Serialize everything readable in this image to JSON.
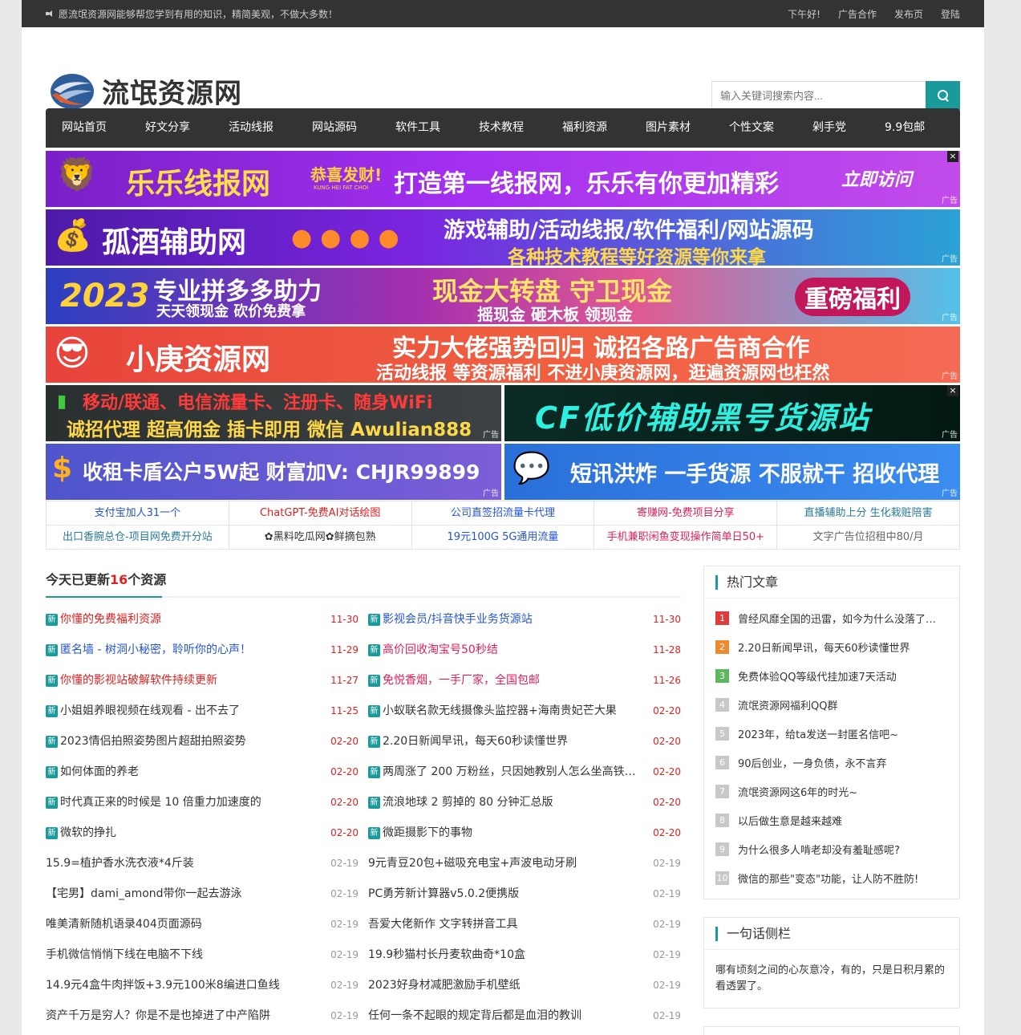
{
  "topbar": {
    "notice": "愿流氓资源网能够帮您学到有用的知识，精简美观，不做大多数！",
    "links": [
      "下午好!",
      "广告合作",
      "发布页",
      "登陆"
    ]
  },
  "site": {
    "logo_text": "流氓资源网"
  },
  "search": {
    "placeholder": "输入关键词搜索内容..."
  },
  "nav": [
    "网站首页",
    "好文分享",
    "活动线报",
    "网站源码",
    "软件工具",
    "技术教程",
    "福利资源",
    "图片素材",
    "个性文案",
    "剁手党",
    "9.9包邮"
  ],
  "ads": {
    "tag": "广告",
    "close": "×",
    "ad1": {
      "title": "乐乐线报网",
      "badge": "恭喜发财!",
      "badge_sub": "KUNG HEI FAT CHOI",
      "slogan": "打造第一线报网，乐乐有你更加精彩",
      "cta": "立即访问"
    },
    "ad2": {
      "title": "孤酒辅助网",
      "line1": "游戏辅助/活动线报/软件福利/网站源码",
      "line2": "各种技术教程等好资源等你来拿"
    },
    "ad3": {
      "year": "2023",
      "line1": "专业拼多多助力",
      "line2": "天天领现金 砍价免费拿",
      "line3": "现金大转盘 守卫现金",
      "line4": "摇现金 砸木板 领现金",
      "badge": "重磅福利"
    },
    "ad4": {
      "title": "小庚资源网",
      "line1": "实力大佬强势回归 诚招各路广告商合作",
      "line2": "活动线报 等资源福利 不进小庚资源网，逛遍资源网也枉然"
    },
    "ad5": {
      "line1": "移动/联通、电信流量卡、注册卡、随身WiFi",
      "line2": "诚招代理 超高佣金 插卡即用 微信 Awulian888"
    },
    "ad6": {
      "title": "CF低价辅助黑号货源站"
    },
    "ad7": {
      "title": "收租卡盾公户5W起 财富加V: CHJR99899"
    },
    "ad8": {
      "title": "短讯洪炸 一手货源 不服就干 招收代理"
    }
  },
  "text_ads": [
    [
      {
        "t": "支付宝加人31一个",
        "c": "blue"
      },
      {
        "t": "ChatGPT-免费AI对话绘图",
        "c": "red"
      },
      {
        "t": "公司直签招流量卡代理",
        "c": "blue"
      },
      {
        "t": "寄赚网-免费项目分享",
        "c": "pink"
      },
      {
        "t": "直播辅助上分 生化栽赃陪害",
        "c": "teal"
      }
    ],
    [
      {
        "t": "出口香腕总仓-项目网免费开分站",
        "c": "teal"
      },
      {
        "t": "✿黑料吃瓜网✿鲜摘包熟",
        "c": "blk"
      },
      {
        "t": "19元100G 5G通用流量",
        "c": "blue"
      },
      {
        "t": "手机兼职闲鱼变现操作简单日50+",
        "c": "pink"
      },
      {
        "t": "文字广告位招租中80/月",
        "c": "gray"
      }
    ]
  ],
  "main": {
    "title_pre": "今天已更新",
    "count": "16",
    "title_post": "个资源",
    "badge": "新",
    "left": [
      {
        "t": "你懂的免费福利资源",
        "d": "11-30",
        "c": "red",
        "new": true
      },
      {
        "t": "匿名墙 - 树洞小秘密，聆听你的心声！",
        "d": "11-29",
        "c": "blue",
        "new": true
      },
      {
        "t": "你懂的影视站破解软件持续更新",
        "d": "11-27",
        "c": "red",
        "new": true
      },
      {
        "t": "小姐姐养眼视频在线观看 - 出不去了",
        "d": "11-25",
        "c": "blk",
        "new": true
      },
      {
        "t": "2023情侣拍照姿势图片超甜拍照姿势",
        "d": "02-20",
        "c": "blk",
        "new": true
      },
      {
        "t": "如何体面的养老",
        "d": "02-20",
        "c": "blk",
        "new": true
      },
      {
        "t": "时代真正来的时候是 10 倍重力加速度的",
        "d": "02-20",
        "c": "blk",
        "new": true
      },
      {
        "t": "微软的挣扎",
        "d": "02-20",
        "c": "blk",
        "new": true
      },
      {
        "t": "15.9=植护香水洗衣液*4斤装",
        "d": "02-19",
        "c": "blk",
        "new": false
      },
      {
        "t": "【宅男】dami_amond带你一起去游泳",
        "d": "02-19",
        "c": "blk",
        "new": false
      },
      {
        "t": "唯美清新随机语录404页面源码",
        "d": "02-19",
        "c": "blk",
        "new": false
      },
      {
        "t": "手机微信悄悄下线在电脑不下线",
        "d": "02-19",
        "c": "blk",
        "new": false
      },
      {
        "t": "14.9元4盒牛肉拌饭+3.9元100米8编进口鱼线",
        "d": "02-19",
        "c": "blk",
        "new": false
      },
      {
        "t": "资产千万是穷人？你是不是也掉进了中产陷阱",
        "d": "02-19",
        "c": "blk",
        "new": false
      }
    ],
    "right": [
      {
        "t": "影视会员/抖音快手业务货源站",
        "d": "11-30",
        "c": "blue",
        "new": true
      },
      {
        "t": "高价回收淘宝号50秒结",
        "d": "11-28",
        "c": "pink",
        "new": true
      },
      {
        "t": "免悦香烟，一手厂家，全国包邮",
        "d": "11-26",
        "c": "pink",
        "new": true
      },
      {
        "t": "小蚁联名款无线摄像头监控器+海南贵妃芒大果",
        "d": "02-20",
        "c": "blk",
        "new": true
      },
      {
        "t": "2.20日新闻早讯，每天60秒读懂世界",
        "d": "02-20",
        "c": "blk",
        "new": true
      },
      {
        "t": "两周涨了 200 万粉丝，只因她教别人怎么坐高铁…",
        "d": "02-20",
        "c": "blk",
        "new": true
      },
      {
        "t": "流浪地球 2 剪掉的 80 分钟汇总版",
        "d": "02-20",
        "c": "blk",
        "new": true
      },
      {
        "t": "微距摄影下的事物",
        "d": "02-20",
        "c": "blk",
        "new": true
      },
      {
        "t": "9元青豆20包+磁吸充电宝+声波电动牙刷",
        "d": "02-19",
        "c": "blk",
        "new": false
      },
      {
        "t": "PC勇芳新计算器v5.0.2便携版",
        "d": "02-19",
        "c": "blk",
        "new": false
      },
      {
        "t": "吾爱大佬新作 文字转拼音工具",
        "d": "02-19",
        "c": "blk",
        "new": false
      },
      {
        "t": "19.9秒猫村长丹麦软曲奇*10盒",
        "d": "02-19",
        "c": "blk",
        "new": false
      },
      {
        "t": "2023好身材减肥激励手机壁纸",
        "d": "02-19",
        "c": "blk",
        "new": false
      },
      {
        "t": "任何一条不起眼的规定背后都是血泪的教训",
        "d": "02-19",
        "c": "blk",
        "new": false
      }
    ]
  },
  "sidebar": {
    "hot_title": "热门文章",
    "hot": [
      {
        "n": "1",
        "t": "曾经风靡全国的迅雷，如今为什么没落了…",
        "color": "#e03c3c"
      },
      {
        "n": "2",
        "t": "2.20日新闻早讯，每天60秒读懂世界",
        "color": "#f08a30"
      },
      {
        "n": "3",
        "t": "免费体验QQ等级代挂加速7天活动",
        "color": "#5cb85c"
      },
      {
        "n": "4",
        "t": "流氓资源网福利QQ群",
        "color": "#c8c8c8"
      },
      {
        "n": "5",
        "t": "2023年，给ta发送一封匿名信吧~",
        "color": "#c8c8c8"
      },
      {
        "n": "6",
        "t": "90后创业，一身负债，永不言弃",
        "color": "#c8c8c8"
      },
      {
        "n": "7",
        "t": "流氓资源网这6年的时光~",
        "color": "#c8c8c8"
      },
      {
        "n": "8",
        "t": "以后做生意是越来越难",
        "color": "#c8c8c8"
      },
      {
        "n": "9",
        "t": "为什么很多人啃老却没有羞耻感呢?",
        "color": "#c8c8c8"
      },
      {
        "n": "10",
        "t": "微信的那些\"变态\"功能，让人防不胜防!",
        "color": "#c8c8c8"
      }
    ],
    "quote_title": "一句话侧栏",
    "quote": "哪有顷刻之间的心灰意冷，有的，只是日积月累的看透罢了。"
  },
  "colors": {
    "accent": "#1a9a9a",
    "dark": "#333333",
    "hot": "#e02020"
  }
}
